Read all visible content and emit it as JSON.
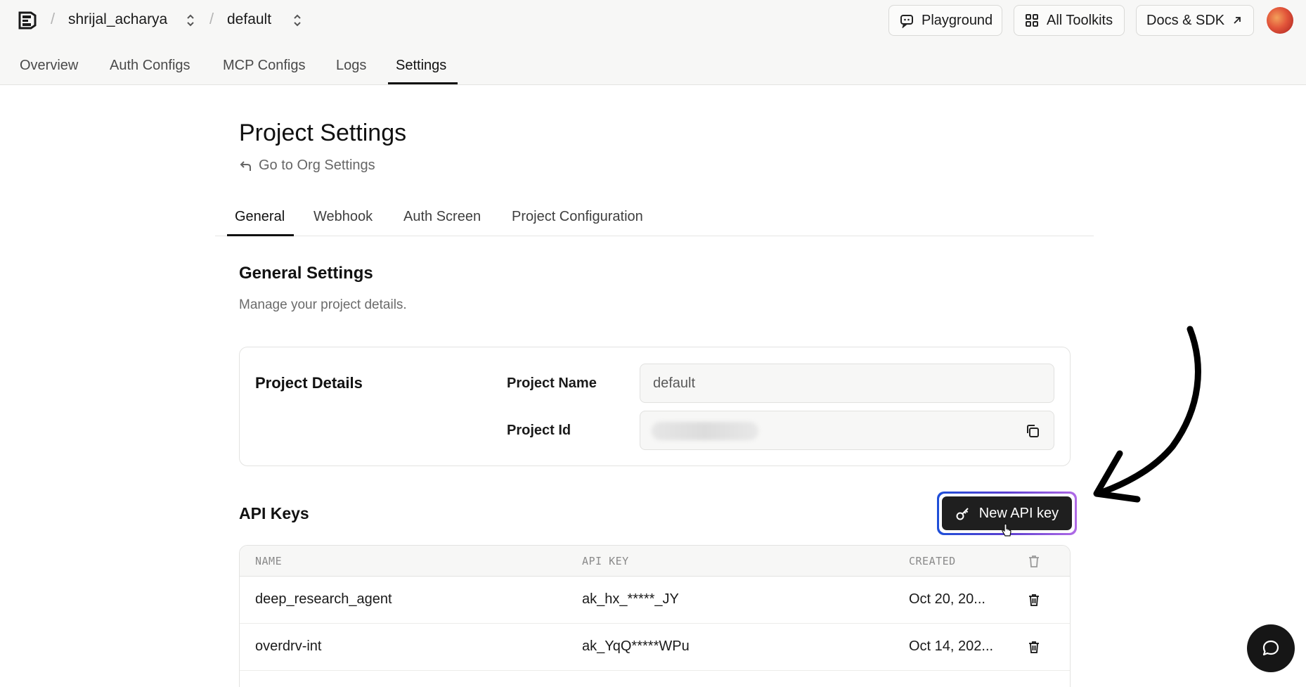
{
  "header": {
    "org": "shrijal_acharya",
    "project": "default",
    "separator": "/",
    "buttons": {
      "playground": "Playground",
      "toolkits": "All Toolkits",
      "docs": "Docs & SDK"
    }
  },
  "nav": {
    "tabs": [
      "Overview",
      "Auth Configs",
      "MCP Configs",
      "Logs",
      "Settings"
    ],
    "active": "Settings"
  },
  "page": {
    "title": "Project Settings",
    "back_link": "Go to Org Settings"
  },
  "sub_tabs": {
    "tabs": [
      "General",
      "Webhook",
      "Auth Screen",
      "Project Configuration"
    ],
    "active": "General"
  },
  "general": {
    "title": "General Settings",
    "description": "Manage your project details."
  },
  "project_details": {
    "heading": "Project Details",
    "name_label": "Project Name",
    "name_value": "default",
    "id_label": "Project Id"
  },
  "api_keys": {
    "title": "API Keys",
    "new_button": "New API key",
    "columns": [
      "NAME",
      "API KEY",
      "CREATED"
    ],
    "rows": [
      {
        "name": "deep_research_agent",
        "key": "ak_hx_*****_JY",
        "created": "Oct 20, 20..."
      },
      {
        "name": "overdrv-int",
        "key": "ak_YqQ*****WPu",
        "created": "Oct 14, 202..."
      }
    ]
  },
  "colors": {
    "accent_dark": "#1f1f1f",
    "ring_start": "#1e4fd8",
    "ring_end": "#b06ae6",
    "topbar_bg": "#f7f7f6"
  }
}
